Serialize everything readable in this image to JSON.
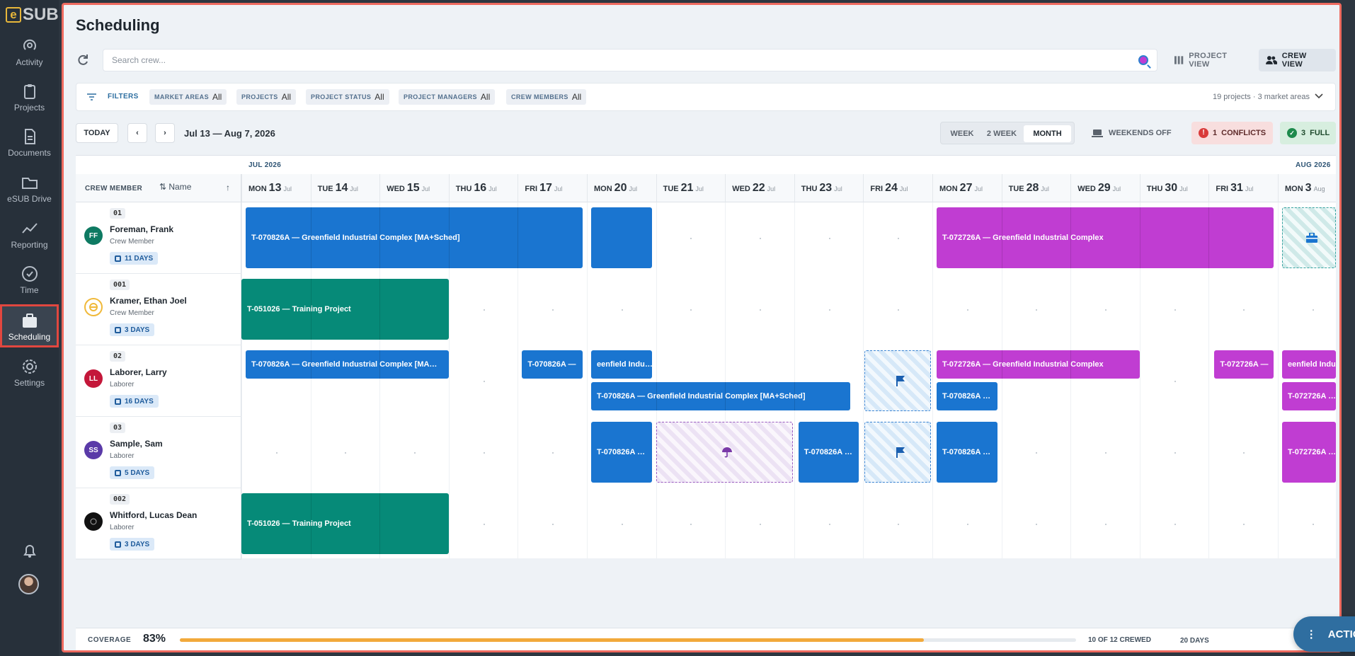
{
  "app": {
    "logo_text": "SUB",
    "logo_mark": "e"
  },
  "sidebar": {
    "items": [
      {
        "label": "Activity",
        "icon": "activity-icon"
      },
      {
        "label": "Projects",
        "icon": "clipboard-icon"
      },
      {
        "label": "Documents",
        "icon": "document-icon"
      },
      {
        "label": "eSUB Drive",
        "icon": "folder-icon"
      },
      {
        "label": "Reporting",
        "icon": "trend-icon"
      },
      {
        "label": "Time",
        "icon": "clock-icon"
      },
      {
        "label": "Scheduling",
        "icon": "briefcase-icon"
      },
      {
        "label": "Settings",
        "icon": "gear-icon"
      }
    ]
  },
  "page": {
    "title": "Scheduling"
  },
  "search": {
    "placeholder": "Search crew..."
  },
  "views": {
    "project": "PROJECT VIEW",
    "crew": "CREW VIEW"
  },
  "filters": {
    "label": "FILTERS",
    "chips": [
      {
        "name": "MARKET AREAS",
        "value": "All"
      },
      {
        "name": "PROJECTS",
        "value": "All"
      },
      {
        "name": "PROJECT STATUS",
        "value": "All"
      },
      {
        "name": "PROJECT MANAGERS",
        "value": "All"
      },
      {
        "name": "CREW MEMBERS",
        "value": "All"
      }
    ],
    "summary": "19 projects · 3 market areas"
  },
  "toolbar": {
    "today": "TODAY",
    "range": "Jul 13 — Aug 7, 2026",
    "modes": [
      "WEEK",
      "2 WEEK",
      "MONTH"
    ],
    "weekends": "WEEKENDS OFF",
    "conflicts_count": "1",
    "conflicts_label": "CONFLICTS",
    "full_count": "3",
    "full_label": "FULL"
  },
  "grid": {
    "crew_header": "CREW MEMBER",
    "sort_label": "Name",
    "months": [
      "JUL 2026",
      "AUG 2026"
    ],
    "days": [
      {
        "dow": "MON",
        "num": "13",
        "mon": "Jul"
      },
      {
        "dow": "TUE",
        "num": "14",
        "mon": "Jul"
      },
      {
        "dow": "WED",
        "num": "15",
        "mon": "Jul"
      },
      {
        "dow": "THU",
        "num": "16",
        "mon": "Jul"
      },
      {
        "dow": "FRI",
        "num": "17",
        "mon": "Jul"
      },
      {
        "dow": "MON",
        "num": "20",
        "mon": "Jul"
      },
      {
        "dow": "TUE",
        "num": "21",
        "mon": "Jul"
      },
      {
        "dow": "WED",
        "num": "22",
        "mon": "Jul"
      },
      {
        "dow": "THU",
        "num": "23",
        "mon": "Jul"
      },
      {
        "dow": "FRI",
        "num": "24",
        "mon": "Jul"
      },
      {
        "dow": "MON",
        "num": "27",
        "mon": "Jul"
      },
      {
        "dow": "TUE",
        "num": "28",
        "mon": "Jul"
      },
      {
        "dow": "WED",
        "num": "29",
        "mon": "Jul"
      },
      {
        "dow": "THU",
        "num": "30",
        "mon": "Jul"
      },
      {
        "dow": "FRI",
        "num": "31",
        "mon": "Jul"
      },
      {
        "dow": "MON",
        "num": "3",
        "mon": "Aug"
      }
    ],
    "crew": [
      {
        "code": "01",
        "initials": "FF",
        "name": "Foreman, Frank",
        "role": "Crew Member",
        "days": "11 DAYS",
        "avatar_color": "#0e7a62"
      },
      {
        "code": "001",
        "initials": "",
        "name": "Kramer, Ethan Joel",
        "role": "Crew Member",
        "days": "3 DAYS",
        "avatar_color": "#ffffff"
      },
      {
        "code": "02",
        "initials": "LL",
        "name": "Laborer, Larry",
        "role": "Laborer",
        "days": "16 DAYS",
        "avatar_color": "#c4173a"
      },
      {
        "code": "03",
        "initials": "SS",
        "name": "Sample, Sam",
        "role": "Laborer",
        "days": "5 DAYS",
        "avatar_color": "#5a3aa8"
      },
      {
        "code": "002",
        "initials": "",
        "name": "Whitford, Lucas Dean",
        "role": "Laborer",
        "days": "3 DAYS",
        "avatar_color": "#111111"
      }
    ],
    "labels": {
      "a_long": "T-070826A — Greenfield Industrial Complex [MA+Sched]",
      "a_trunc": "T-070826A — Greenfield Industrial Complex [MA…",
      "a_short": "T-070826A —",
      "a_tail": "eenfield Indu…",
      "a_mini": "T-070826A …",
      "b_long": "T-072726A — Greenfield Industrial Complex",
      "b_short": "T-072726A —",
      "b_tail": "eenfield Indu…",
      "b_mini": "T-072726A …",
      "c_long": "T-051026 — Training Project"
    }
  },
  "coverage": {
    "label": "COVERAGE",
    "percent": "83%",
    "fraction": 0.83,
    "crewed": "10 OF 12 CREWED",
    "days": "20 DAYS"
  },
  "actions": {
    "label": "ACTIONS"
  },
  "colors": {
    "accent_blue": "#1a75d0",
    "teal": "#068a78",
    "magenta": "#c03dd2",
    "conflict": "#d93b3b",
    "full": "#1d8a4c"
  }
}
